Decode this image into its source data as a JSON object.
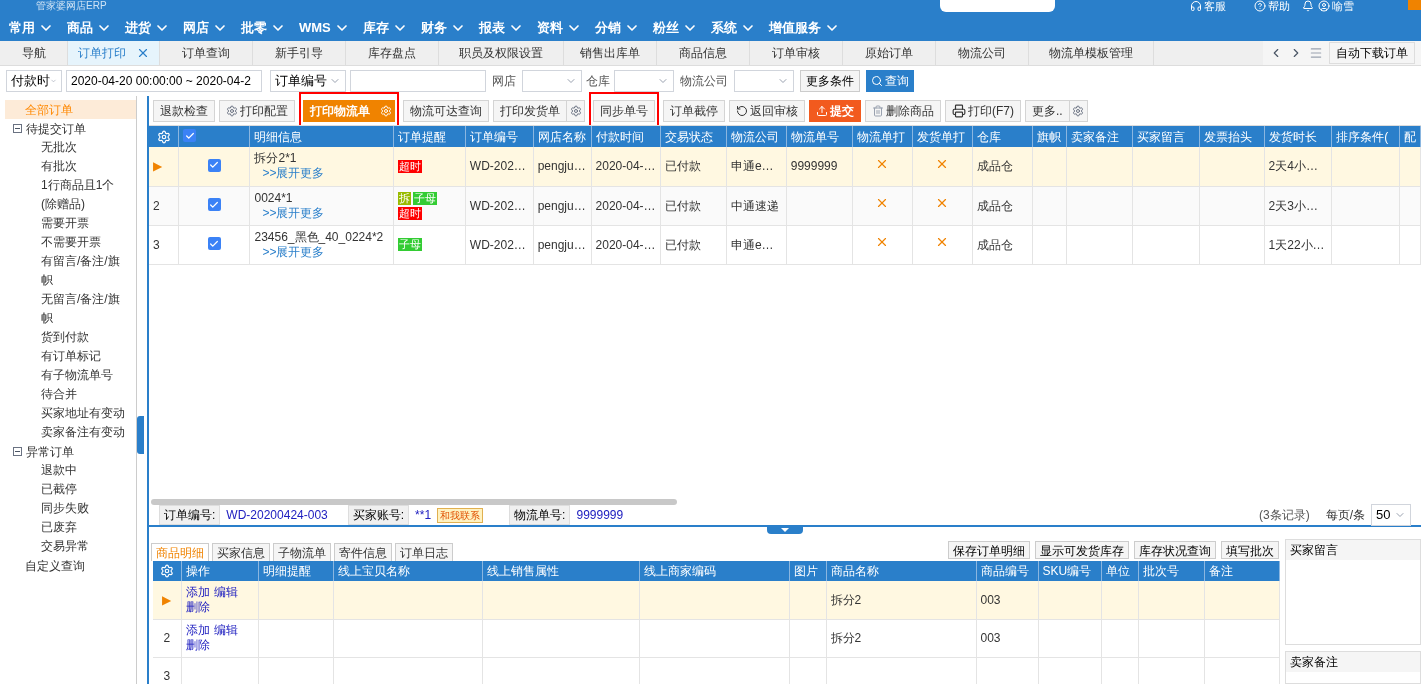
{
  "header": {
    "logo": "管家婆网店ERP",
    "links": [
      {
        "label": "客服"
      },
      {
        "label": "帮助"
      },
      {
        "label": "喻雪"
      }
    ]
  },
  "nav": [
    "常用",
    "商品",
    "进货",
    "网店",
    "批零",
    "WMS",
    "库存",
    "财务",
    "报表",
    "资料",
    "分销",
    "粉丝",
    "系统",
    "增值服务"
  ],
  "tabs": [
    {
      "label": "导航",
      "selected": false,
      "closable": false
    },
    {
      "label": "订单打印",
      "selected": true,
      "closable": true
    },
    {
      "label": "订单查询",
      "selected": false,
      "closable": false
    },
    {
      "label": "新手引导",
      "selected": false,
      "closable": false
    },
    {
      "label": "库存盘点",
      "selected": false,
      "closable": false
    },
    {
      "label": "职员及权限设置",
      "selected": false,
      "closable": false
    },
    {
      "label": "销售出库单",
      "selected": false,
      "closable": false
    },
    {
      "label": "商品信息",
      "selected": false,
      "closable": false
    },
    {
      "label": "订单审核",
      "selected": false,
      "closable": false
    },
    {
      "label": "原始订单",
      "selected": false,
      "closable": false
    },
    {
      "label": "物流公司",
      "selected": false,
      "closable": false
    },
    {
      "label": "物流单模板管理",
      "selected": false,
      "closable": false
    }
  ],
  "tab_actions": {
    "auto_download": "自动下载订单"
  },
  "filters": {
    "time_type": "付款时",
    "date_range": "2020-04-20 00:00:00 ~ 2020-04-2",
    "order_field": "订单编号",
    "shop_label": "网店",
    "warehouse_label": "仓库",
    "logistics_label": "物流公司",
    "more": "更多条件",
    "search": "查询"
  },
  "sidebar": [
    {
      "label": "全部订单",
      "selected": true
    },
    {
      "label": "待提交订单",
      "selected": false,
      "expanded": true,
      "children": [
        {
          "label": "无批次",
          "selected": false
        },
        {
          "label": "有批次",
          "selected": false
        },
        {
          "label": "1行商品且1个(除赠品)",
          "selected": false
        },
        {
          "label": "需要开票",
          "selected": false
        },
        {
          "label": "不需要开票",
          "selected": false
        },
        {
          "label": "有留言/备注/旗帜",
          "selected": false
        },
        {
          "label": "无留言/备注/旗帜",
          "selected": false
        },
        {
          "label": "货到付款",
          "selected": false
        },
        {
          "label": "有订单标记",
          "selected": false
        },
        {
          "label": "有子物流单号",
          "selected": false
        },
        {
          "label": "待合并",
          "selected": false
        },
        {
          "label": "买家地址有变动",
          "selected": false
        },
        {
          "label": "卖家备注有变动",
          "selected": false
        }
      ]
    },
    {
      "label": "异常订单",
      "selected": false,
      "expanded": true,
      "children": [
        {
          "label": "退款中",
          "selected": false
        },
        {
          "label": "已截停",
          "selected": false
        },
        {
          "label": "同步失败",
          "selected": false
        },
        {
          "label": "已废弃",
          "selected": false
        },
        {
          "label": "交易异常",
          "selected": false
        }
      ]
    },
    {
      "label": "自定义查询",
      "selected": false
    }
  ],
  "toolbar": [
    {
      "label": "退款检查",
      "kind": "plain",
      "highlighted": false
    },
    {
      "label": "打印配置",
      "kind": "plain",
      "highlighted": false
    },
    {
      "label": "打印物流单",
      "kind": "primary",
      "highlighted": true
    },
    {
      "label": "物流可达查询",
      "kind": "plain",
      "highlighted": false
    },
    {
      "label": "打印发货单",
      "kind": "plain",
      "highlighted": false
    },
    {
      "label": "同步单号",
      "kind": "plain",
      "highlighted": true
    },
    {
      "label": "订单截停",
      "kind": "plain",
      "highlighted": false
    },
    {
      "label": "返回审核",
      "kind": "plain",
      "highlighted": false
    },
    {
      "label": "提交",
      "kind": "danger",
      "highlighted": false
    },
    {
      "label": "删除商品",
      "kind": "plain",
      "highlighted": false
    },
    {
      "label": "打印(F7)",
      "kind": "plain",
      "highlighted": false
    },
    {
      "label": "更多..",
      "kind": "plain",
      "highlighted": false
    }
  ],
  "table": {
    "all_checked": true,
    "columns": [
      "明细信息",
      "订单提醒",
      "订单编号",
      "网店名称",
      "付款时间",
      "交易状态",
      "物流公司",
      "物流单号",
      "物流单打",
      "发货单打",
      "仓库",
      "旗帜",
      "卖家备注",
      "买家留言",
      "发票抬头",
      "发货时长",
      "排序条件(",
      "配"
    ],
    "rows": [
      {
        "marker": "▶",
        "selected": true,
        "checked": true,
        "detail": "拆分2*1",
        "expand": ">>展开更多",
        "tags": [
          {
            "label": "超时",
            "color": "#ff0000"
          }
        ],
        "order_no": "WD-202…",
        "shop": "pengju…",
        "paid_at": "2020-04-…",
        "status": "已付款",
        "logistics": "申通e…",
        "tracking_no": "9999999",
        "waybill_printed": false,
        "invoice_printed": false,
        "warehouse": "成品仓",
        "duration": "2天4小…"
      },
      {
        "marker": "2",
        "selected": false,
        "checked": true,
        "detail": "0024*1",
        "expand": ">>展开更多",
        "tags": [
          {
            "label": "拆",
            "color": "#99bb00"
          },
          {
            "label": "子母",
            "color": "#33cc33"
          },
          {
            "label": "超时",
            "color": "#ff0000"
          }
        ],
        "order_no": "WD-202…",
        "shop": "pengju…",
        "paid_at": "2020-04-…",
        "status": "已付款",
        "logistics": "中通速递",
        "tracking_no": "",
        "waybill_printed": false,
        "invoice_printed": false,
        "warehouse": "成品仓",
        "duration": "2天3小…"
      },
      {
        "marker": "3",
        "selected": false,
        "checked": true,
        "detail": "23456_黑色_40_0224*2",
        "expand": ">>展开更多",
        "tags": [
          {
            "label": "子母",
            "color": "#33cc33"
          }
        ],
        "order_no": "WD-202…",
        "shop": "pengju…",
        "paid_at": "2020-04-…",
        "status": "已付款",
        "logistics": "申通e…",
        "tracking_no": "",
        "waybill_printed": false,
        "invoice_printed": false,
        "warehouse": "成品仓",
        "duration": "1天22小…"
      }
    ]
  },
  "info_bar": {
    "order_label": "订单编号:",
    "order_value": "WD-20200424-003",
    "buyer_label": "买家账号:",
    "buyer_value": "**1",
    "contact": "和我联系",
    "tracking_label": "物流单号:",
    "tracking_value": "9999999",
    "record_count": "(3条记录)",
    "per_page_label": "每页/条",
    "per_page": "50"
  },
  "detail_tabs": [
    {
      "label": "商品明细",
      "selected": true
    },
    {
      "label": "买家信息",
      "selected": false
    },
    {
      "label": "子物流单",
      "selected": false
    },
    {
      "label": "寄件信息",
      "selected": false
    },
    {
      "label": "订单日志",
      "selected": false
    }
  ],
  "detail_actions": [
    "保存订单明细",
    "显示可发货库存",
    "库存状况查询",
    "填写批次"
  ],
  "detail_table": {
    "columns": [
      "操作",
      "明细提醒",
      "线上宝贝名称",
      "线上销售属性",
      "线上商家编码",
      "图片",
      "商品名称",
      "商品编号",
      "SKU编号",
      "单位",
      "批次号",
      "备注"
    ],
    "rows": [
      {
        "marker": "▶",
        "selected": true,
        "actions": [
          "添加",
          "编辑",
          "删除"
        ],
        "product_name": "拆分2",
        "product_no": "003"
      },
      {
        "marker": "2",
        "selected": false,
        "actions": [
          "添加",
          "编辑",
          "删除"
        ],
        "product_name": "拆分2",
        "product_no": "003"
      },
      {
        "marker": "3",
        "selected": false,
        "actions": [],
        "product_name": "",
        "product_no": ""
      }
    ]
  },
  "side_panel": {
    "buyer_message": "买家留言",
    "seller_note": "卖家备注"
  }
}
